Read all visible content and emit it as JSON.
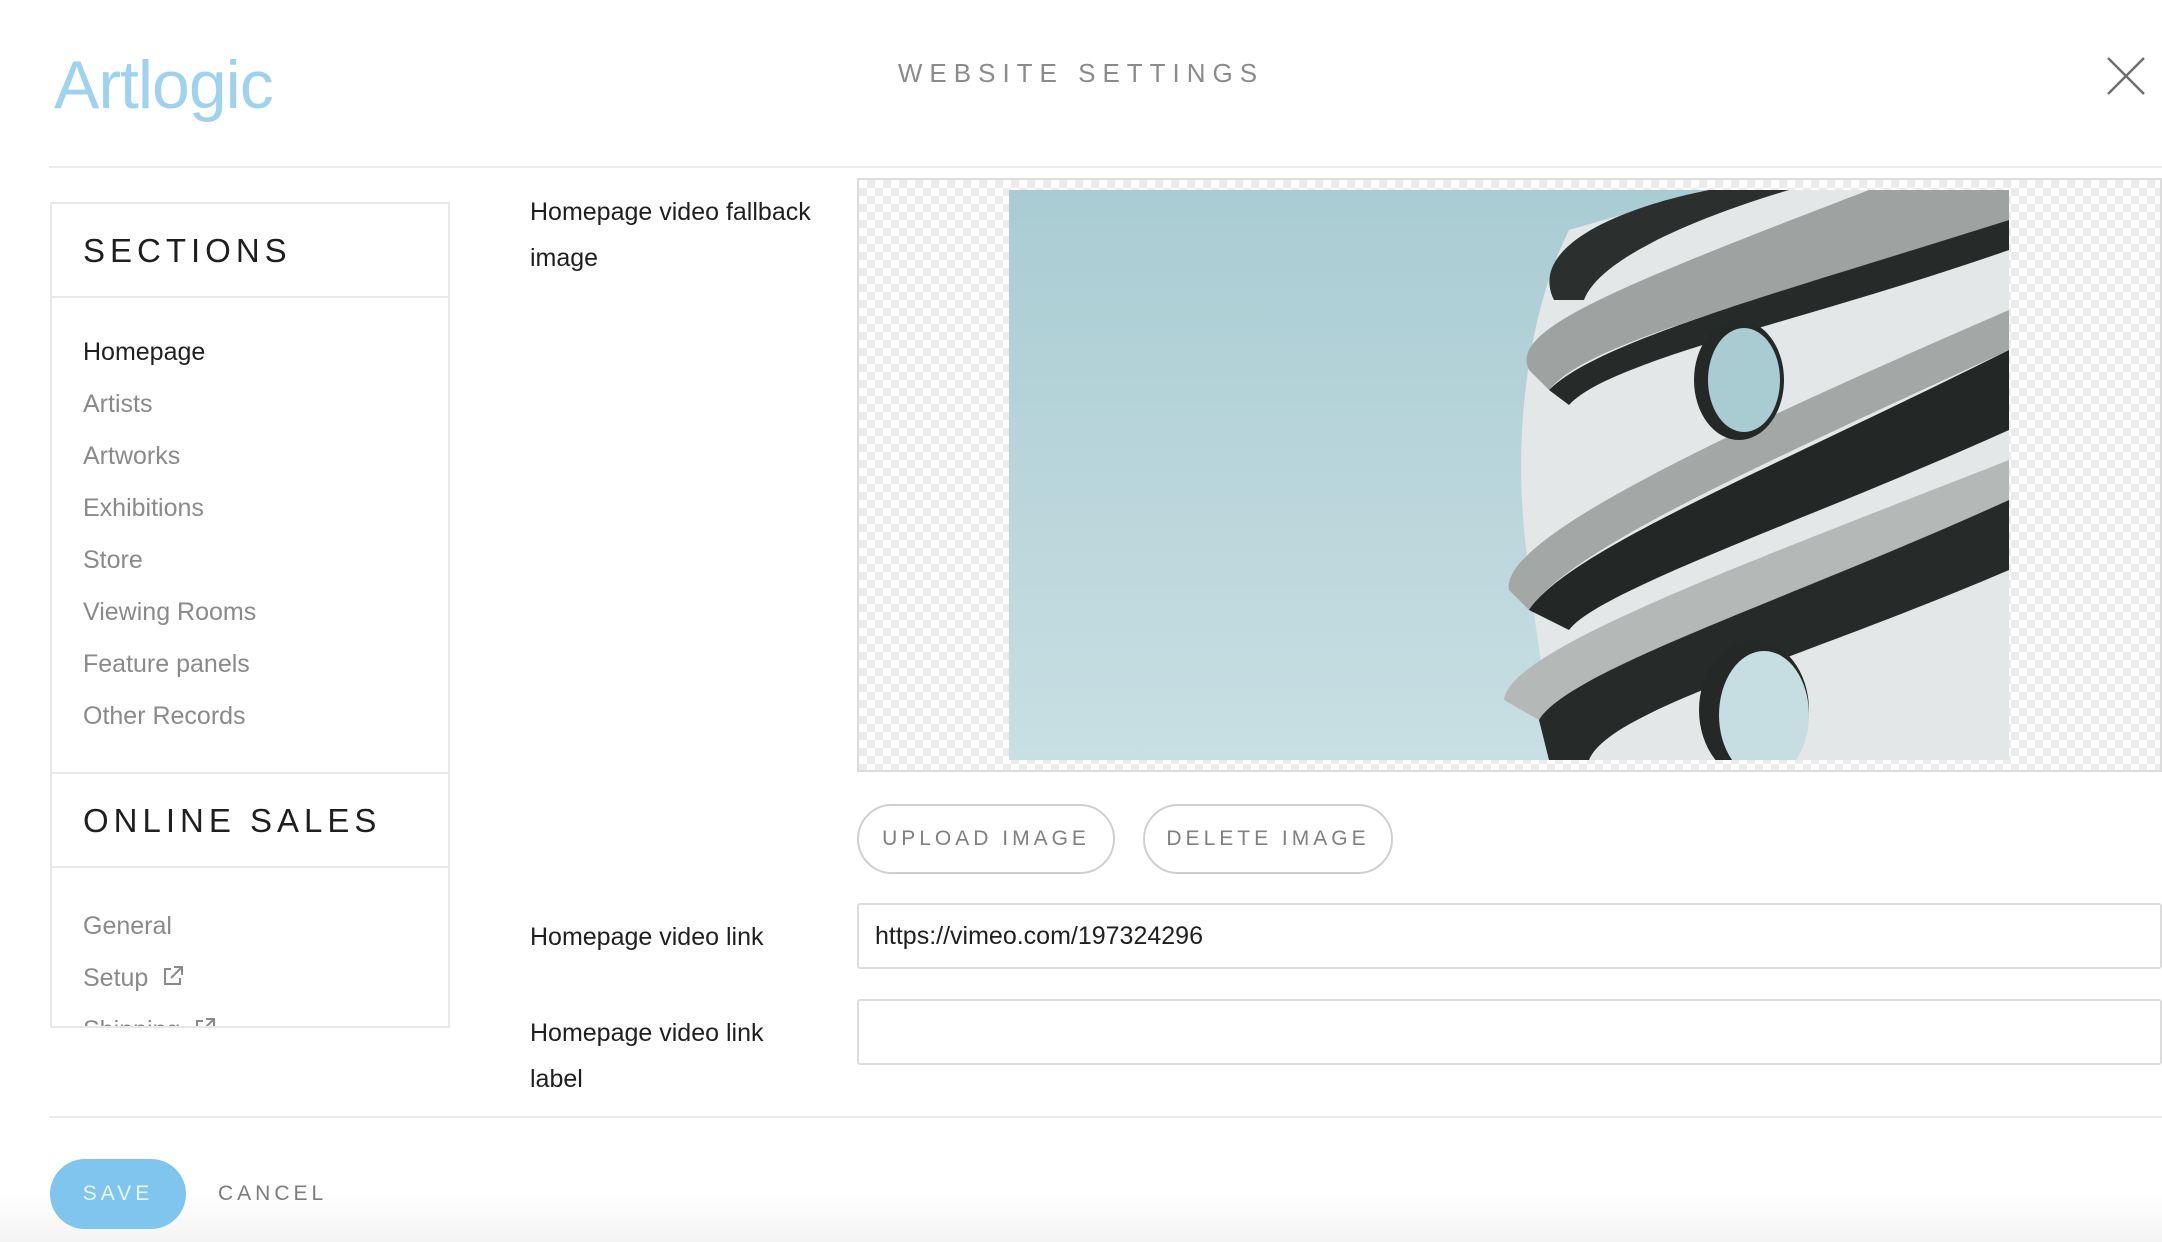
{
  "header": {
    "logo_text": "Artlogic",
    "title": "WEBSITE SETTINGS",
    "close_icon": "close-icon"
  },
  "sidebar": {
    "sections_heading": "SECTIONS",
    "sections_items": [
      {
        "label": "Homepage",
        "active": true
      },
      {
        "label": "Artists",
        "active": false
      },
      {
        "label": "Artworks",
        "active": false
      },
      {
        "label": "Exhibitions",
        "active": false
      },
      {
        "label": "Store",
        "active": false
      },
      {
        "label": "Viewing Rooms",
        "active": false
      },
      {
        "label": "Feature panels",
        "active": false
      },
      {
        "label": "Other Records",
        "active": false
      }
    ],
    "online_sales_heading": "ONLINE SALES",
    "online_sales_items": [
      {
        "label": "General",
        "icon": ""
      },
      {
        "label": "Setup",
        "icon": "external-link-icon"
      },
      {
        "label": "Shipping",
        "icon": "external-link-icon"
      }
    ]
  },
  "form": {
    "fallback_image_label": "Homepage video fallback image",
    "upload_image_label": "UPLOAD IMAGE",
    "delete_image_label": "DELETE IMAGE",
    "video_link_label": "Homepage video link",
    "video_link_value": "https://vimeo.com/197324296",
    "video_link_label_label": "Homepage video link label",
    "video_link_label_value": ""
  },
  "footer": {
    "save_label": "SAVE",
    "cancel_label": "CANCEL"
  },
  "colors": {
    "brand": "#9fd2ee",
    "save_button": "#7fc5ee",
    "muted_text": "#8a8a8a",
    "border": "#dcdcdc"
  }
}
